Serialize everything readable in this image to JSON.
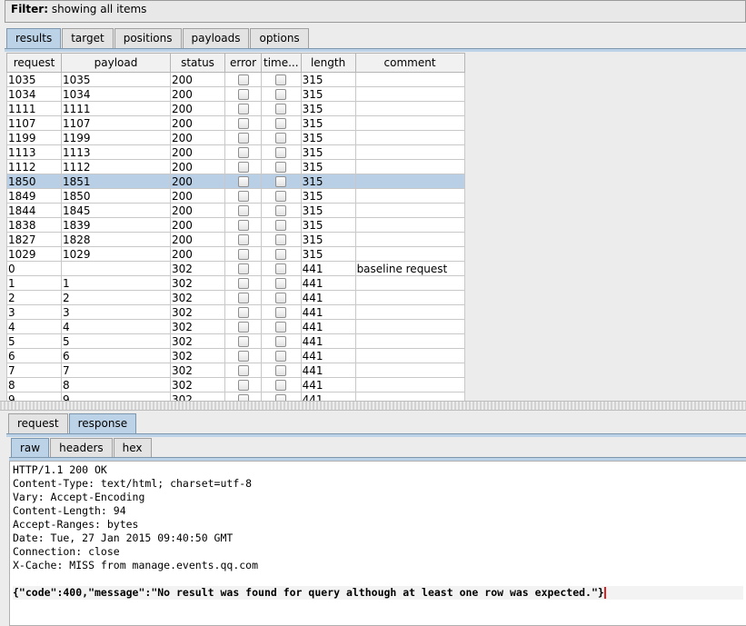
{
  "filter": {
    "label": "Filter:",
    "text": "showing all items"
  },
  "main_tabs": [
    "results",
    "target",
    "positions",
    "payloads",
    "options"
  ],
  "columns": [
    "request",
    "payload",
    "status",
    "error",
    "time...",
    "length",
    "comment"
  ],
  "rows": [
    {
      "request": "1035",
      "payload": "1035",
      "status": "200",
      "length": "315",
      "comment": ""
    },
    {
      "request": "1034",
      "payload": "1034",
      "status": "200",
      "length": "315",
      "comment": ""
    },
    {
      "request": "1111",
      "payload": "1111",
      "status": "200",
      "length": "315",
      "comment": ""
    },
    {
      "request": "1107",
      "payload": "1107",
      "status": "200",
      "length": "315",
      "comment": ""
    },
    {
      "request": "1199",
      "payload": "1199",
      "status": "200",
      "length": "315",
      "comment": ""
    },
    {
      "request": "1113",
      "payload": "1113",
      "status": "200",
      "length": "315",
      "comment": ""
    },
    {
      "request": "1112",
      "payload": "1112",
      "status": "200",
      "length": "315",
      "comment": ""
    },
    {
      "request": "1850",
      "payload": "1851",
      "status": "200",
      "length": "315",
      "comment": "",
      "selected": true
    },
    {
      "request": "1849",
      "payload": "1850",
      "status": "200",
      "length": "315",
      "comment": ""
    },
    {
      "request": "1844",
      "payload": "1845",
      "status": "200",
      "length": "315",
      "comment": ""
    },
    {
      "request": "1838",
      "payload": "1839",
      "status": "200",
      "length": "315",
      "comment": ""
    },
    {
      "request": "1827",
      "payload": "1828",
      "status": "200",
      "length": "315",
      "comment": ""
    },
    {
      "request": "1029",
      "payload": "1029",
      "status": "200",
      "length": "315",
      "comment": ""
    },
    {
      "request": "0",
      "payload": "",
      "status": "302",
      "length": "441",
      "comment": "baseline request"
    },
    {
      "request": "1",
      "payload": "1",
      "status": "302",
      "length": "441",
      "comment": ""
    },
    {
      "request": "2",
      "payload": "2",
      "status": "302",
      "length": "441",
      "comment": ""
    },
    {
      "request": "3",
      "payload": "3",
      "status": "302",
      "length": "441",
      "comment": ""
    },
    {
      "request": "4",
      "payload": "4",
      "status": "302",
      "length": "441",
      "comment": ""
    },
    {
      "request": "5",
      "payload": "5",
      "status": "302",
      "length": "441",
      "comment": ""
    },
    {
      "request": "6",
      "payload": "6",
      "status": "302",
      "length": "441",
      "comment": ""
    },
    {
      "request": "7",
      "payload": "7",
      "status": "302",
      "length": "441",
      "comment": ""
    },
    {
      "request": "8",
      "payload": "8",
      "status": "302",
      "length": "441",
      "comment": ""
    },
    {
      "request": "9",
      "payload": "9",
      "status": "302",
      "length": "441",
      "comment": ""
    }
  ],
  "detail_tabs": [
    "request",
    "response"
  ],
  "view_tabs": [
    "raw",
    "headers",
    "hex"
  ],
  "response_lines": [
    "HTTP/1.1 200 OK",
    "Content-Type: text/html; charset=utf-8",
    "Vary: Accept-Encoding",
    "Content-Length: 94",
    "Accept-Ranges: bytes",
    "Date: Tue, 27 Jan 2015 09:40:50 GMT",
    "Connection: close",
    "X-Cache: MISS from manage.events.qq.com",
    ""
  ],
  "response_body": "{\"code\":400,\"message\":\"No result was found for query although at least one row was expected.\"}",
  "colors": {
    "selected_row": "#b8cfe5",
    "active_tab": "#bcd2e6",
    "caret": "#e02020"
  }
}
